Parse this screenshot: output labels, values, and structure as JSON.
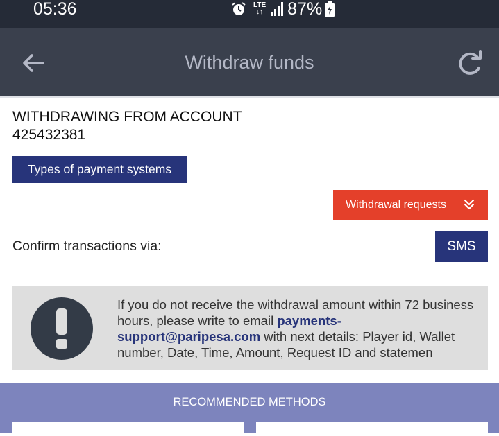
{
  "status_bar": {
    "time": "05:36",
    "network": "LTE",
    "battery": "87%"
  },
  "header": {
    "title": "Withdraw funds",
    "back_icon": "arrow-left-icon",
    "refresh_icon": "refresh-icon"
  },
  "account": {
    "heading": "WITHDRAWING FROM ACCOUNT",
    "number": "425432381"
  },
  "buttons": {
    "payment_types": "Types of payment systems",
    "withdrawal_requests": "Withdrawal requests",
    "sms": "SMS"
  },
  "confirm": {
    "label": "Confirm transactions via:"
  },
  "notice": {
    "icon": "exclamation-icon",
    "text_before": "If you do not receive the withdrawal amount within 72 business hours, please write to email ",
    "email": "payments-support@paripesa.com",
    "text_after": "  with next details: Player id, Wallet number, Date, Time, Amount, Request ID and statemen"
  },
  "recommended": {
    "title": "RECOMMENDED METHODS"
  },
  "colors": {
    "status_bar": "#252b37",
    "app_bar": "#3a404d",
    "primary_navy": "#27347a",
    "accent_red": "#e4402a",
    "recommended_bg": "#7d84bd",
    "notice_bg": "#dedede"
  }
}
